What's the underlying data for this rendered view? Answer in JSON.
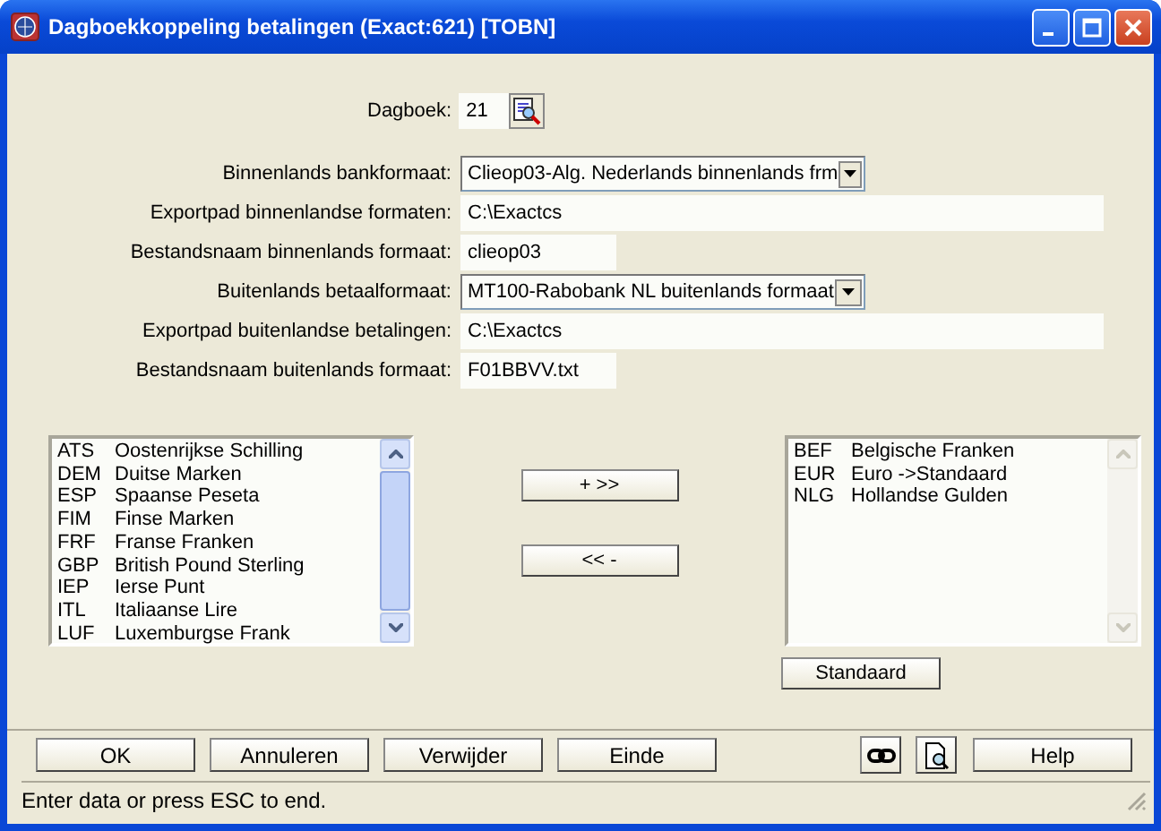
{
  "window": {
    "title": "Dagboekkoppeling betalingen (Exact:621) [TOBN]"
  },
  "dagboek": {
    "label": "Dagboek:",
    "value": "21"
  },
  "fields": [
    {
      "kind": "dropdown",
      "label": "Binnenlands bankformaat:",
      "value": "Clieop03-Alg. Nederlands binnenlands frm"
    },
    {
      "kind": "wide",
      "label": "Exportpad binnenlandse formaten:",
      "value": "C:\\Exactcs"
    },
    {
      "kind": "short",
      "label": "Bestandsnaam binnenlands formaat:",
      "value": "clieop03"
    },
    {
      "kind": "dropdown",
      "label": "Buitenlands betaalformaat:",
      "value": "MT100-Rabobank NL buitenlands formaat"
    },
    {
      "kind": "wide",
      "label": "Exportpad buitenlandse betalingen:",
      "value": "C:\\Exactcs"
    },
    {
      "kind": "short",
      "label": "Bestandsnaam buitenlands formaat:",
      "value": "F01BBVV.txt"
    }
  ],
  "available": [
    {
      "code": "ATS",
      "name": "Oostenrijkse Schilling"
    },
    {
      "code": "DEM",
      "name": "Duitse Marken"
    },
    {
      "code": "ESP",
      "name": "Spaanse Peseta"
    },
    {
      "code": "FIM",
      "name": "Finse Marken"
    },
    {
      "code": "FRF",
      "name": "Franse Franken"
    },
    {
      "code": "GBP",
      "name": "British Pound Sterling"
    },
    {
      "code": "IEP",
      "name": "Ierse Punt"
    },
    {
      "code": "ITL",
      "name": "Italiaanse Lire"
    },
    {
      "code": "LUF",
      "name": "Luxemburgse Frank"
    }
  ],
  "move_buttons": [
    "+ >>",
    "<< -"
  ],
  "chosen": [
    {
      "code": "BEF",
      "name": "Belgische Franken"
    },
    {
      "code": "EUR",
      "name": "Euro ->Standaard"
    },
    {
      "code": "NLG",
      "name": "Hollandse Gulden"
    }
  ],
  "standard_button": "Standaard",
  "buttons": [
    "OK",
    "Annuleren",
    "Verwijder",
    "Einde"
  ],
  "help_button": "Help",
  "status_bar": "Enter data or press ESC to end."
}
